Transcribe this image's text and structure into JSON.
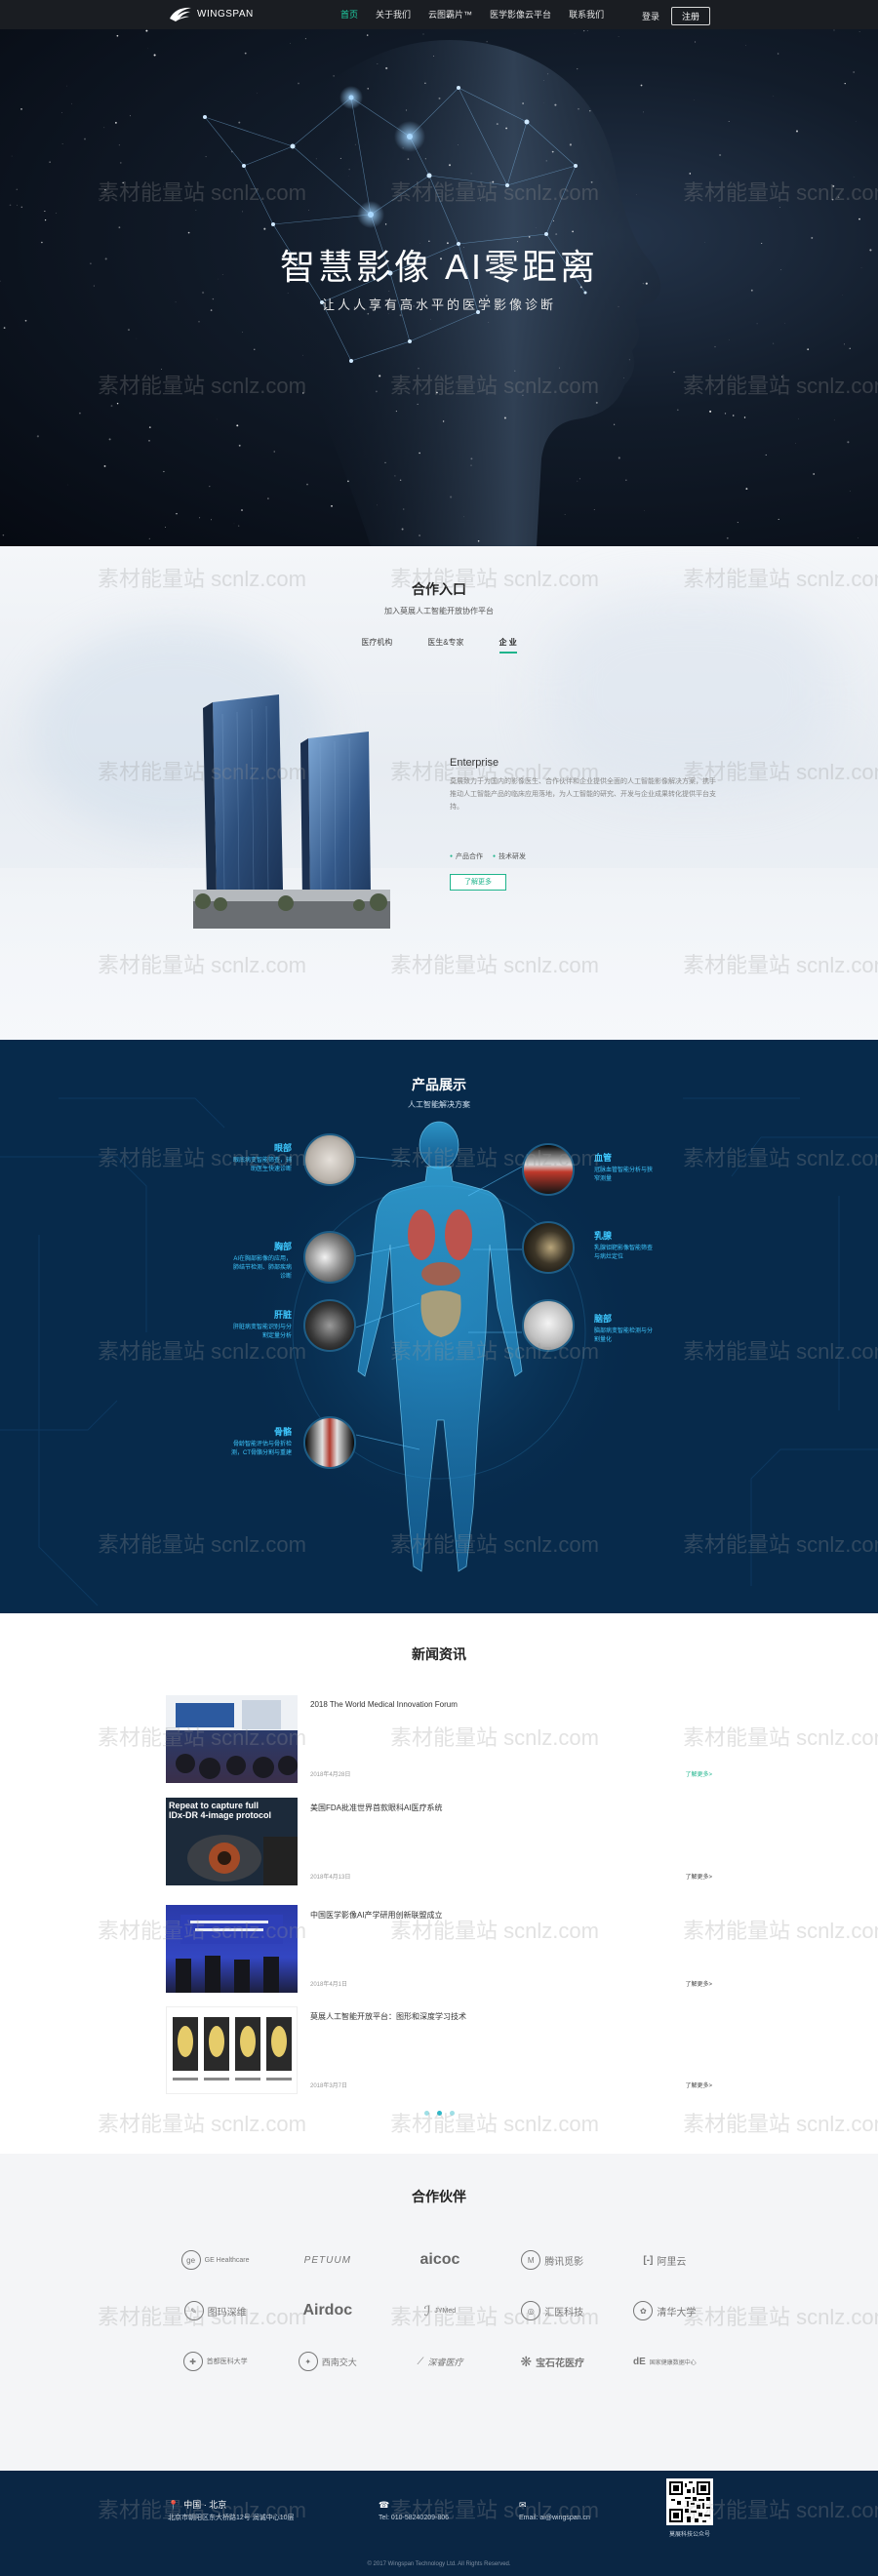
{
  "nav": {
    "brand": "WINGSPAN",
    "links": [
      "首页",
      "关于我们",
      "云图霸片™",
      "医学影像云平台",
      "联系我们"
    ],
    "login": "登录",
    "register": "注册"
  },
  "hero": {
    "title": "智慧影像  AI零距离",
    "subtitle": "让人人享有高水平的医学影像诊断"
  },
  "entry": {
    "title": "合作入口",
    "subtitle": "加入莫展人工智能开放协作平台",
    "tabs": [
      "医疗机构",
      "医生&专家",
      "企 业"
    ],
    "enterprise_title": "Enterprise",
    "enterprise_desc": "莫展致力于为国内的影像医生、合作伙伴和企业提供全面的人工智能影像解决方案，携手推动人工智能产品的临床应用落地，为人工智能的研究、开发与企业成果转化提供平台支持。",
    "tags": [
      "产品合作",
      "技术研发"
    ],
    "more": "了解更多"
  },
  "products": {
    "title": "产品展示",
    "subtitle": "人工智能解决方案",
    "items": [
      {
        "name": "眼部",
        "desc": "眼底病变智能筛查，辅助医生快速诊断"
      },
      {
        "name": "胸部",
        "desc": "AI在胸部影像的应用，肺结节检测、肺部疾病诊断"
      },
      {
        "name": "肝脏",
        "desc": "肝脏病变智能识别与分割定量分析"
      },
      {
        "name": "骨骼",
        "desc": "骨龄智能评估与骨折检测，CT骨骼分割与重建"
      },
      {
        "name": "血管",
        "desc": "冠脉血管智能分析与狭窄测量"
      },
      {
        "name": "乳腺",
        "desc": "乳腺钼靶影像智能筛查与病灶定位"
      },
      {
        "name": "脑部",
        "desc": "脑部病变智能检测与分割量化"
      }
    ]
  },
  "news": {
    "title": "新闻资讯",
    "more_label": "了解更多>",
    "items": [
      {
        "title": "2018 The World Medical Innovation Forum",
        "date": "2018年4月28日"
      },
      {
        "title": "美国FDA批准世界首款眼科AI医疗系统",
        "date": "2018年4月13日"
      },
      {
        "title": "中国医学影像AI产学研用创新联盟成立",
        "date": "2018年4月1日"
      },
      {
        "title": "莫展人工智能开放平台：图形和深度学习技术",
        "date": "2018年3月7日"
      }
    ],
    "thumb_texts": [
      "Repeat to capture full",
      "IDx-DR 4-image protocol"
    ]
  },
  "partners": {
    "title": "合作伙伴",
    "logos": [
      "GE Healthcare",
      "PETUUM",
      "aicoc",
      "腾讯觅影",
      "阿里云",
      "图玛深维",
      "Airdoc",
      "JYMed",
      "汇医科技",
      "清华大学",
      "首都医科大学",
      "西南交大",
      "深睿医疗",
      "宝石花医疗",
      "国家健康数据中心"
    ]
  },
  "footer": {
    "location": "中国 · 北京",
    "address": "北京市朝阳区东大桥路12号 润诚中心10层",
    "phone": "Tel: 010-58240209-806",
    "email": "Email: ai@wingspan.cn",
    "qr_label": "莫展科技公众号",
    "copyright": "© 2017 Wingspan Technology Ltd. All Rights Reserved."
  },
  "watermark": "素材能量站 scnlz.com"
}
